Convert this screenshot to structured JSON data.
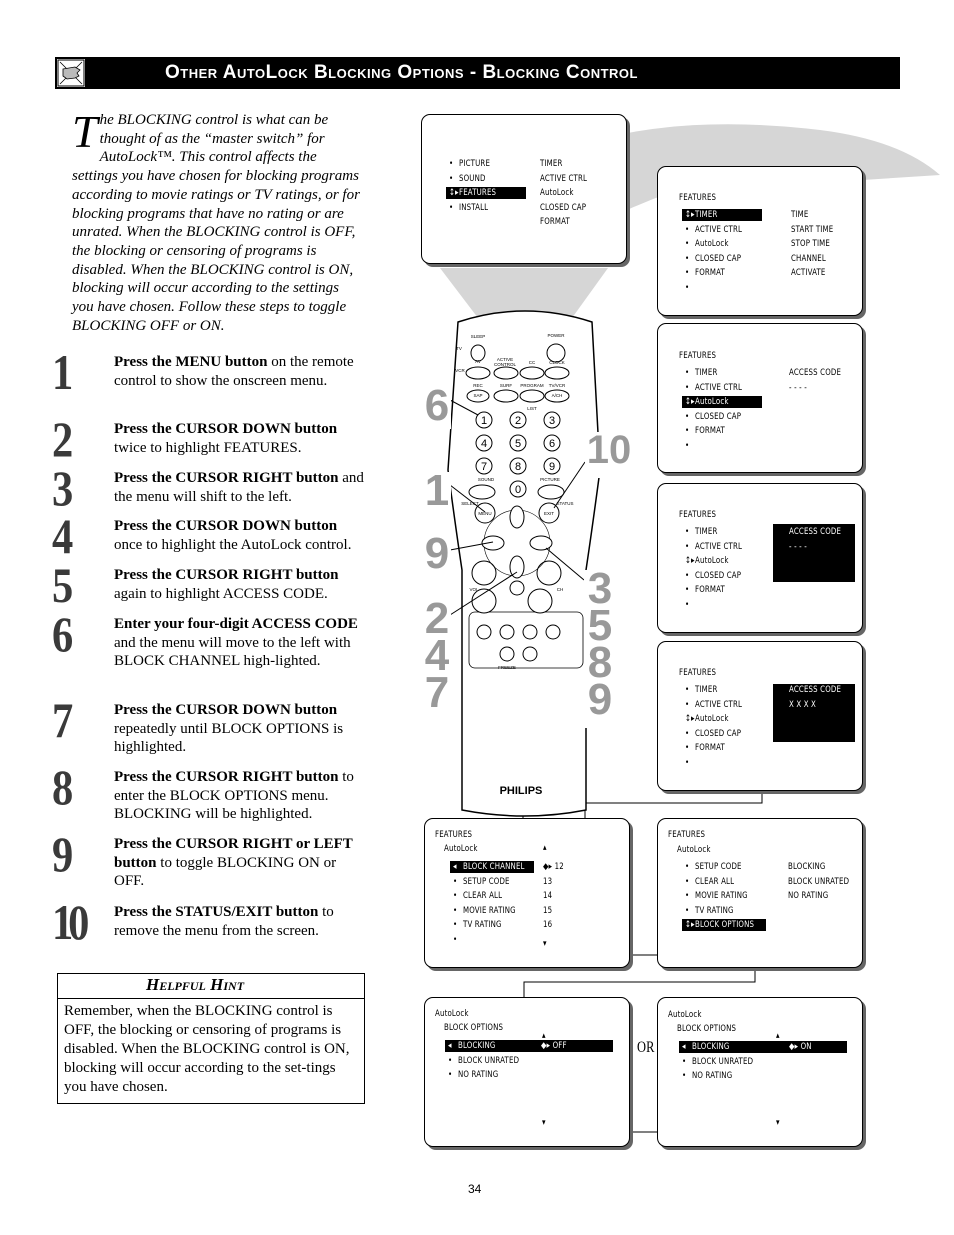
{
  "header": {
    "title": "Other AutoLock Blocking Options - Blocking Control",
    "icon": "hand-pointing-icon"
  },
  "intro": {
    "dropcap": "T",
    "text": "he BLOCKING control is what can be thought of as the “master switch” for AutoLock™. This control affects the settings you have chosen for blocking programs according to movie ratings or TV ratings, or for blocking programs that have no rating or are unrated. When the BLOCKING control is OFF, the blocking or censoring of programs is disabled. When the BLOCKING control is ON, blocking will occur according to the settings you have chosen. Follow these steps to toggle BLOCKING OFF or ON."
  },
  "steps": [
    {
      "num": "1",
      "bold": "Press the MENU button",
      "rest": " on the remote control to show the onscreen menu."
    },
    {
      "num": "2",
      "bold": "Press the CURSOR DOWN button",
      "rest": " twice to highlight FEATURES."
    },
    {
      "num": "3",
      "bold": "Press the CURSOR RIGHT button",
      "rest": " and the menu will shift to the left."
    },
    {
      "num": "4",
      "bold": "Press the CURSOR DOWN button",
      "rest": " once to highlight the AutoLock control."
    },
    {
      "num": "5",
      "bold": "Press the CURSOR RIGHT button",
      "rest": " again to highlight ACCESS CODE."
    },
    {
      "num": "6",
      "bold": "Enter your four-digit ACCESS CODE",
      "rest": " and the menu will move to the left with BLOCK CHANNEL high-lighted."
    },
    {
      "num": "7",
      "bold": "Press the CURSOR DOWN button",
      "rest": " repeatedly until BLOCK OPTIONS is highlighted."
    },
    {
      "num": "8",
      "bold": "Press the CURSOR RIGHT button",
      "rest": " to enter the BLOCK OPTIONS menu. BLOCKING will be highlighted."
    },
    {
      "num": "9",
      "bold": "Press the CURSOR RIGHT or LEFT button",
      "rest": " to toggle BLOCKING ON or OFF."
    },
    {
      "num": "10",
      "bold": "Press the STATUS/EXIT button",
      "rest": " to remove the menu from the screen."
    }
  ],
  "hint": {
    "title": "Helpful Hint",
    "text": "Remember, when the BLOCKING control is OFF, the blocking or censoring of programs is disabled. When the BLOCKING control is ON, blocking will occur according to the set-tings you have chosen."
  },
  "remote": {
    "brand": "PHILIPS",
    "labels": [
      "SLEEP",
      "POWER",
      "TV",
      "VCR",
      "AV",
      "ACTIVE",
      "CONTROL",
      "CC",
      "CLOCK",
      "REC",
      "SAP",
      "SURF",
      "PROGRAM",
      "LIST",
      "TV/VCR",
      "A/CH",
      "SOUND",
      "PICTURE",
      "SELECT",
      "MENU",
      "EXIT",
      "STATUS",
      "VOL",
      "CH",
      "FREEZE"
    ],
    "digits": [
      "1",
      "2",
      "3",
      "4",
      "5",
      "6",
      "7",
      "8",
      "9",
      "0"
    ],
    "callouts": [
      "6",
      "1",
      "9",
      "2\n4\n7",
      "10",
      "3\n5\n8\n9"
    ]
  },
  "or_label": "OR",
  "screens": [
    {
      "items": [
        {
          "m": "b",
          "t": "PICTURE"
        },
        {
          "m": "b",
          "t": "SOUND"
        },
        {
          "m": "ud",
          "t": "FEATURES",
          "hl": true
        },
        {
          "m": "b",
          "t": "INSTALL"
        }
      ],
      "right": [
        "TIMER",
        "ACTIVE  CTRL",
        "AutoLock",
        "CLOSED  CAP",
        "FORMAT"
      ]
    },
    {
      "title": "FEATURES",
      "items": [
        {
          "m": "ud",
          "t": "TIMER",
          "hl": true
        },
        {
          "m": "b",
          "t": "ACTIVE  CTRL"
        },
        {
          "m": "b",
          "t": "AutoLock"
        },
        {
          "m": "b",
          "t": "CLOSED  CAP"
        },
        {
          "m": "b",
          "t": "FORMAT"
        },
        {
          "m": "b",
          "t": ""
        }
      ],
      "right": [
        "TIME",
        "START  TIME",
        "STOP  TIME",
        "CHANNEL",
        "ACTIVATE"
      ]
    },
    {
      "title": "FEATURES",
      "items": [
        {
          "m": "b",
          "t": "TIMER"
        },
        {
          "m": "b",
          "t": "ACTIVE  CTRL"
        },
        {
          "m": "ud",
          "t": "AutoLock",
          "hl": true
        },
        {
          "m": "b",
          "t": "CLOSED  CAP"
        },
        {
          "m": "b",
          "t": "FORMAT"
        },
        {
          "m": "b",
          "t": ""
        }
      ],
      "right": [
        "ACCESS  CODE",
        "- - - -"
      ]
    },
    {
      "title": "FEATURES",
      "items": [
        {
          "m": "b",
          "t": "TIMER"
        },
        {
          "m": "b",
          "t": "ACTIVE  CTRL"
        },
        {
          "m": "ud",
          "t": "AutoLock"
        },
        {
          "m": "b",
          "t": "CLOSED  CAP"
        },
        {
          "m": "b",
          "t": "FORMAT"
        },
        {
          "m": "b",
          "t": ""
        }
      ],
      "right": [
        "ACCESS  CODE",
        "- - - -"
      ],
      "right_hl": true
    },
    {
      "title": "FEATURES",
      "items": [
        {
          "m": "b",
          "t": "TIMER"
        },
        {
          "m": "b",
          "t": "ACTIVE  CTRL"
        },
        {
          "m": "ud",
          "t": "AutoLock"
        },
        {
          "m": "b",
          "t": "CLOSED  CAP"
        },
        {
          "m": "b",
          "t": "FORMAT"
        },
        {
          "m": "b",
          "t": ""
        }
      ],
      "right": [
        "ACCESS  CODE",
        "X  X  X  X"
      ],
      "right_hl": true
    },
    {
      "title": "FEATURES",
      "subtitle": "AutoLock",
      "items": [
        {
          "m": "l",
          "t": "BLOCK  CHANNEL",
          "hl": true
        },
        {
          "m": "b",
          "t": "SETUP  CODE"
        },
        {
          "m": "b",
          "t": "CLEAR  ALL"
        },
        {
          "m": "b",
          "t": "MOVIE  RATING"
        },
        {
          "m": "b",
          "t": "TV  RATING"
        },
        {
          "m": "b",
          "t": ""
        }
      ],
      "right": [
        "◆▸  12",
        "13",
        "14",
        "15",
        "16"
      ],
      "arrows": true
    },
    {
      "title": "FEATURES",
      "subtitle": "AutoLock",
      "items": [
        {
          "m": "b",
          "t": "SETUP  CODE"
        },
        {
          "m": "b",
          "t": "CLEAR  ALL"
        },
        {
          "m": "b",
          "t": "MOVIE  RATING"
        },
        {
          "m": "b",
          "t": "TV  RATING"
        },
        {
          "m": "ud",
          "t": "BLOCK  OPTIONS",
          "hl": true
        }
      ],
      "right": [
        "BLOCKING",
        "BLOCK  UNRATED",
        "NO  RATING"
      ]
    },
    {
      "title": "AutoLock",
      "subtitle": "BLOCK  OPTIONS",
      "items": [
        {
          "m": "l",
          "t": "BLOCKING",
          "hl": true,
          "v": "◆▸  OFF"
        },
        {
          "m": "b",
          "t": "BLOCK  UNRATED"
        },
        {
          "m": "b",
          "t": "NO  RATING"
        }
      ],
      "right": [],
      "arrows": true
    },
    {
      "title": "AutoLock",
      "subtitle": "BLOCK  OPTIONS",
      "items": [
        {
          "m": "l",
          "t": "BLOCKING",
          "hl": true,
          "v": "◆▸  ON"
        },
        {
          "m": "b",
          "t": "BLOCK  UNRATED"
        },
        {
          "m": "b",
          "t": "NO  RATING"
        }
      ],
      "right": [],
      "arrows": true
    }
  ],
  "page_number": "34"
}
